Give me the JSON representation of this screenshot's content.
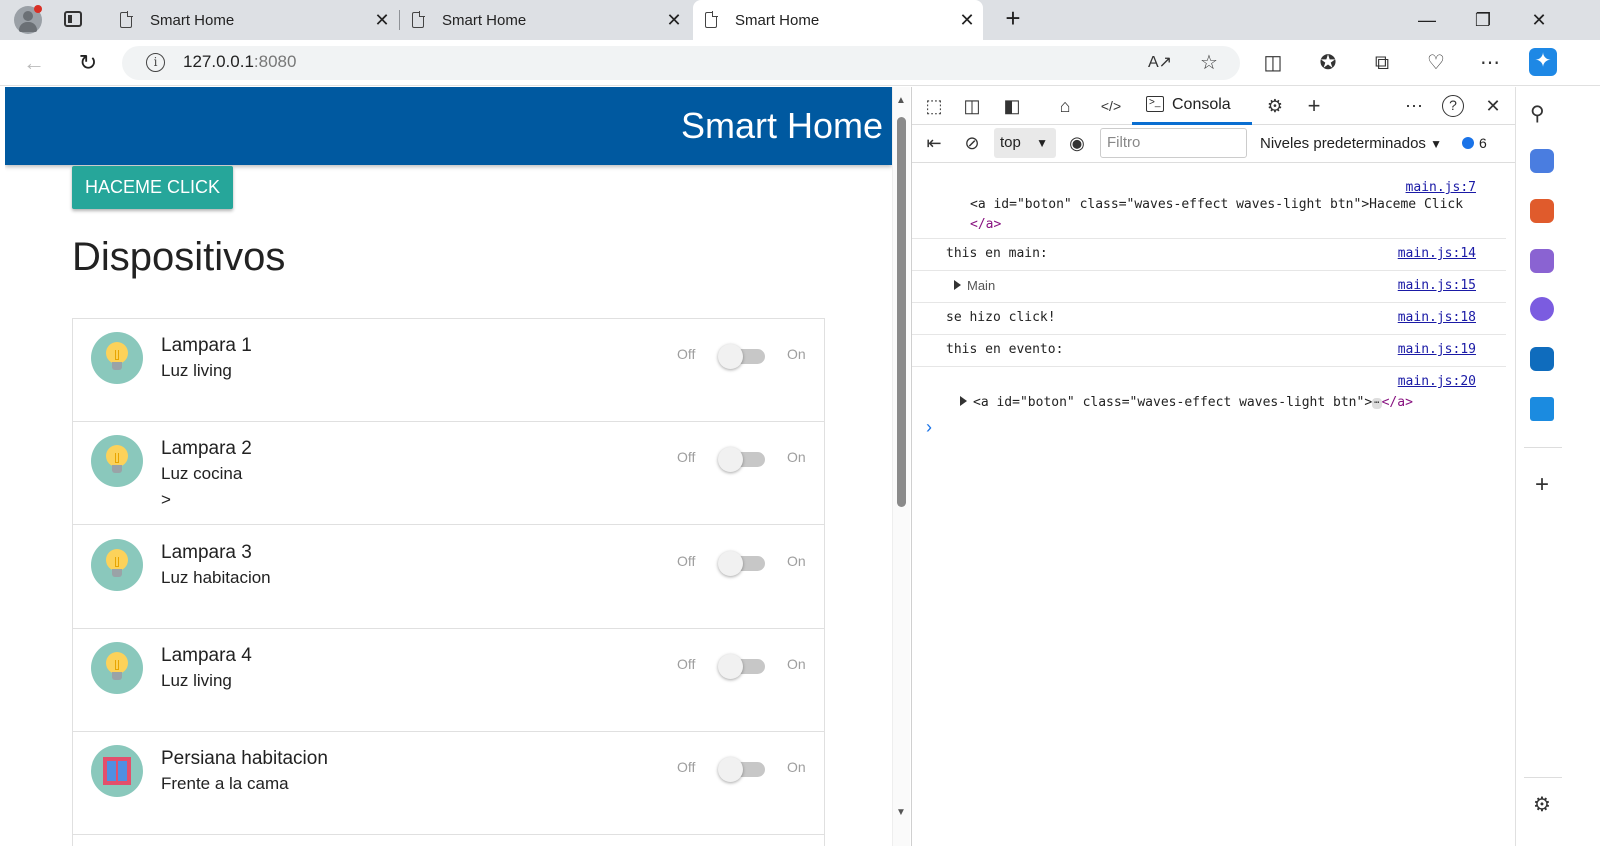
{
  "browser": {
    "tabs": [
      {
        "title": "Smart Home"
      },
      {
        "title": "Smart Home"
      },
      {
        "title": "Smart Home"
      }
    ],
    "url_host": "127.0.0.1",
    "url_port": ":8080",
    "new_tab_label": "+",
    "close_label": "✕"
  },
  "page": {
    "brand": "Smart Home",
    "button_label": "Haceme click",
    "heading": "Dispositivos",
    "switch_off_label": "Off",
    "switch_on_label": "On",
    "devices": [
      {
        "name": "Lampara 1",
        "description": "Luz living",
        "extra": "",
        "icon": "bulb-icon"
      },
      {
        "name": "Lampara 2",
        "description": "Luz cocina",
        "extra": ">",
        "icon": "bulb-icon"
      },
      {
        "name": "Lampara 3",
        "description": "Luz habitacion",
        "extra": "",
        "icon": "bulb-icon"
      },
      {
        "name": "Lampara 4",
        "description": "Luz living",
        "extra": "",
        "icon": "bulb-icon"
      },
      {
        "name": "Persiana habitacion",
        "description": "Frente a la cama",
        "extra": "",
        "icon": "window-blind-icon"
      }
    ]
  },
  "devtools": {
    "console_tab": "Consola",
    "context": "top",
    "filter_placeholder": "Filtro",
    "levels": "Niveles predeterminados",
    "message_count": "6",
    "logs": [
      {
        "source": "main.js:7",
        "line1": "<a id=\"boton\" class=\"waves-effect waves-light btn\">Haceme Click",
        "line2": "</a>"
      },
      {
        "source": "main.js:14",
        "text": "this en main:"
      },
      {
        "source": "main.js:15",
        "text": "Main"
      },
      {
        "source": "main.js:18",
        "text": "se hizo click!"
      },
      {
        "source": "main.js:19",
        "text": "this en evento:"
      },
      {
        "source": "main.js:20",
        "line1": "<a id=\"boton\" class=\"waves-effect waves-light btn\">",
        "line2": "</a>"
      }
    ],
    "prompt": "›"
  },
  "colors": {
    "navbar": "#0059a0",
    "button": "#26a69a",
    "avatar": "#8ac8bc",
    "console_link": "#1a1aa6"
  }
}
